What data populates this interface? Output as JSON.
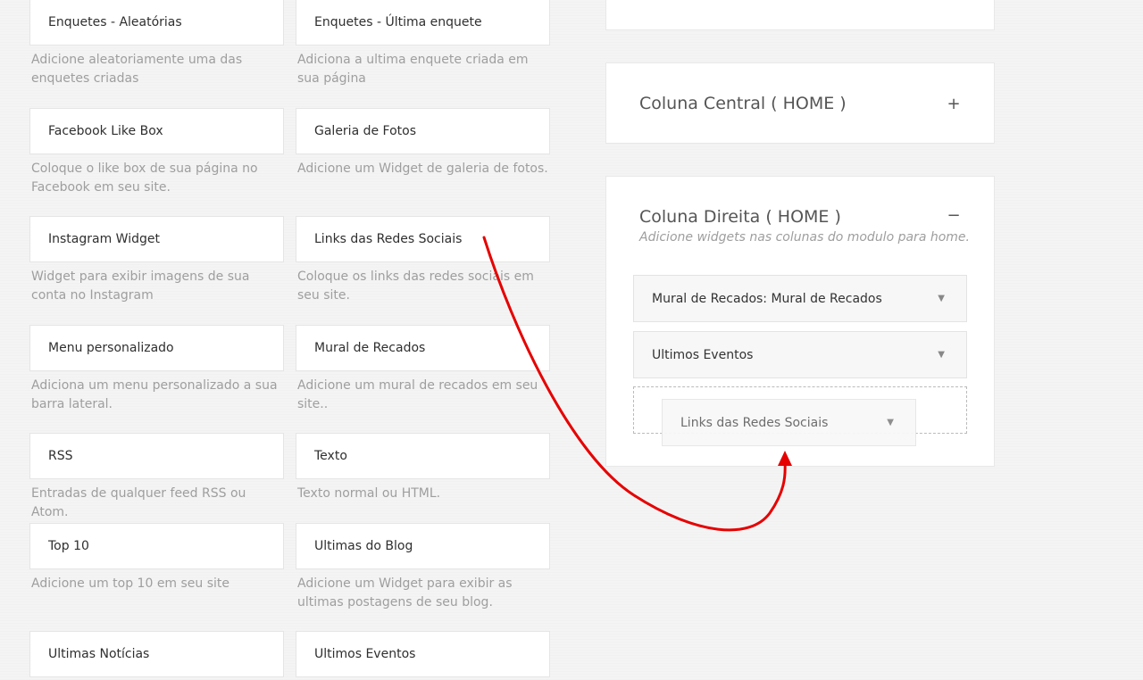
{
  "widgets": [
    {
      "title": "Enquetes - Aleatórias",
      "desc": "Adicione aleatoriamente uma das enquetes criadas"
    },
    {
      "title": "Enquetes - Última enquete",
      "desc": "Adiciona a ultima enquete criada em sua página"
    },
    {
      "title": "Facebook Like Box",
      "desc": "Coloque o like box de sua página no Facebook em seu site."
    },
    {
      "title": "Galeria de Fotos",
      "desc": "Adicione um Widget de galeria de fotos."
    },
    {
      "title": "Instagram Widget",
      "desc": "Widget para exibir imagens de sua conta no Instagram"
    },
    {
      "title": "Links das Redes Sociais",
      "desc": "Coloque os links das redes sociais em seu site."
    },
    {
      "title": "Menu personalizado",
      "desc": "Adiciona um menu personalizado a sua barra lateral."
    },
    {
      "title": "Mural de Recados",
      "desc": "Adicione um mural de recados em seu site.."
    },
    {
      "title": "RSS",
      "desc": "Entradas de qualquer feed RSS ou Atom."
    },
    {
      "title": "Texto",
      "desc": "Texto normal ou HTML."
    },
    {
      "title": "Top 10",
      "desc": "Adicione um top 10 em seu site"
    },
    {
      "title": "Ultimas do Blog",
      "desc": "Adicione um Widget para exibir as ultimas postagens de seu blog."
    },
    {
      "title": "Ultimas Notícias",
      "desc": ""
    },
    {
      "title": "Ultimos Eventos",
      "desc": ""
    }
  ],
  "sidebars": {
    "central": {
      "title": "Coluna Central ( HOME )",
      "toggle": "+"
    },
    "direita": {
      "title": "Coluna Direita ( HOME )",
      "toggle": "−",
      "subtitle": "Adicione widgets nas colunas do modulo para home.",
      "items": [
        {
          "label": "Mural de Recados: Mural de Recados"
        },
        {
          "label": "Ultimos Eventos"
        }
      ],
      "dragging": {
        "label": "Links das Redes Sociais"
      }
    }
  },
  "icons": {
    "caret": "▼"
  },
  "colors": {
    "arrow": "#e60000"
  }
}
